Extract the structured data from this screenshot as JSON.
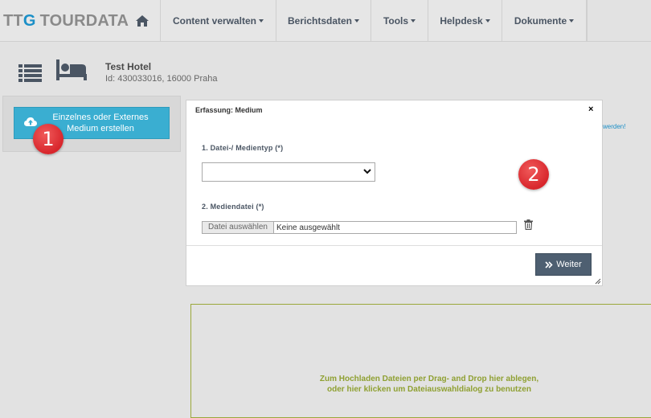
{
  "nav": {
    "logo_ttg": "TT",
    "logo_g": "G",
    "logo_tourdata": "TOURDATA",
    "items": [
      {
        "label": "Content verwalten"
      },
      {
        "label": "Berichtsdaten"
      },
      {
        "label": "Tools"
      },
      {
        "label": "Helpdesk"
      },
      {
        "label": "Dokumente"
      }
    ]
  },
  "hotel": {
    "name": "Test Hotel",
    "id_line": "Id: 430033016, 16000 Praha"
  },
  "create_button": {
    "label": "Einzelnes oder Externes Medium erstellen"
  },
  "markers": {
    "one": "1",
    "two": "2"
  },
  "side_link": "werden!",
  "modal": {
    "title": "Erfassung: Medium",
    "close": "×",
    "field1_label": "1. Datei-/ Medientyp (*)",
    "field1_value": "",
    "field2_label": "2. Mediendatei (*)",
    "file_button": "Datei auswählen",
    "file_status": "Keine ausgewählt",
    "weiter": "Weiter"
  },
  "dropzone": {
    "line1": "Zum Hochladen Dateien per Drag- and Drop hier ablegen,",
    "line2": "oder hier klicken um Dateiauswahldialog zu benutzen"
  },
  "colors": {
    "accent": "#3aaed1",
    "marker": "#d8262c",
    "weiter": "#4e5f71",
    "dropzone_text": "#8fa032"
  }
}
